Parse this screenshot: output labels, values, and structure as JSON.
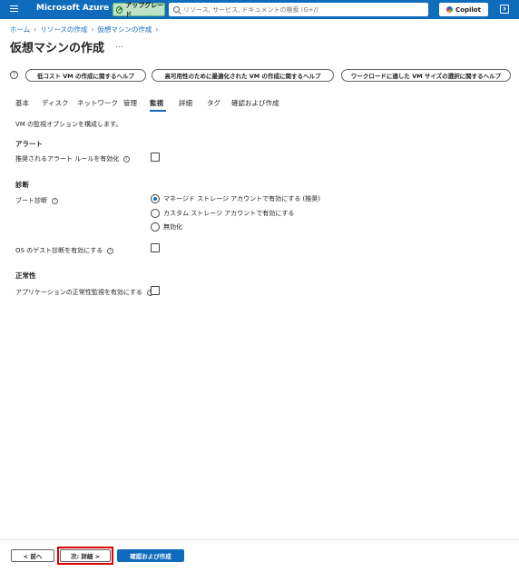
{
  "topbar": {
    "brand": "Microsoft Azure",
    "upgrade_label": "アップグレード",
    "search_placeholder": "リソース, サービス, ドキュメントの検索 (G+/)",
    "copilot_label": "Copilot"
  },
  "breadcrumb": [
    "ホーム",
    "リソースの作成",
    "仮想マシンの作成"
  ],
  "page": {
    "title": "仮想マシンの作成",
    "more": "…"
  },
  "help_buttons": [
    "低コスト VM の作成に関するヘルプ",
    "高可用性のために最適化された VM の作成に関するヘルプ",
    "ワークロードに適した VM サイズの選択に関するヘルプ"
  ],
  "tabs": [
    "基本",
    "ディスク",
    "ネットワーク",
    "管理",
    "監視",
    "詳細",
    "タグ",
    "確認および作成"
  ],
  "active_tab": "監視",
  "description": "VM の監視オプションを構成します。",
  "alerts": {
    "heading": "アラート",
    "enable_label": "推奨されるアラート ルールを有効化",
    "enabled": false
  },
  "diagnostics": {
    "heading": "診断",
    "boot_label": "ブート診断",
    "options": [
      "マネージド ストレージ アカウントで有効にする (推奨)",
      "カスタム ストレージ アカウントで有効にする",
      "無効化"
    ],
    "selected": "マネージド ストレージ アカウントで有効にする (推奨)",
    "os_guest_label": "OS のゲスト診断を有効にする",
    "os_guest_enabled": false
  },
  "health": {
    "heading": "正常性",
    "app_health_label": "アプリケーションの正常性監視を有効にする",
    "enabled": false
  },
  "footer": {
    "prev": "< 前へ",
    "next": "次: 詳細 >",
    "review": "確認および作成"
  },
  "colors": {
    "azure_blue": "#0f6cbd",
    "highlight_red": "#e00000",
    "upgrade_green": "#bfe3c6"
  }
}
